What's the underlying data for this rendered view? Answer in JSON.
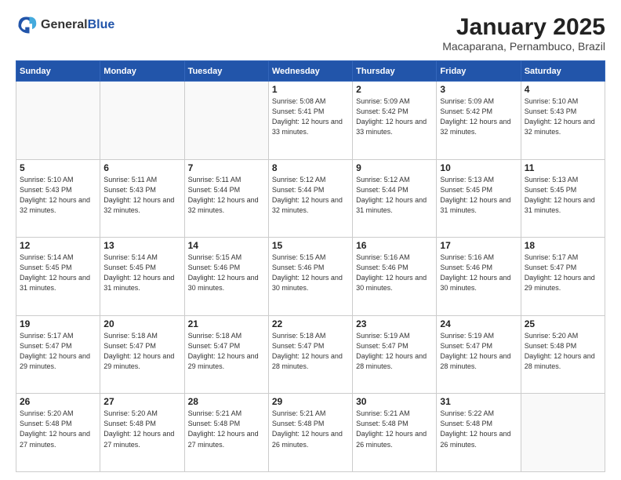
{
  "logo": {
    "general": "General",
    "blue": "Blue"
  },
  "header": {
    "month": "January 2025",
    "location": "Macaparana, Pernambuco, Brazil"
  },
  "weekdays": [
    "Sunday",
    "Monday",
    "Tuesday",
    "Wednesday",
    "Thursday",
    "Friday",
    "Saturday"
  ],
  "weeks": [
    [
      {
        "day": null
      },
      {
        "day": null
      },
      {
        "day": null
      },
      {
        "day": "1",
        "sunrise": "5:08 AM",
        "sunset": "5:41 PM",
        "daylight": "12 hours and 33 minutes."
      },
      {
        "day": "2",
        "sunrise": "5:09 AM",
        "sunset": "5:42 PM",
        "daylight": "12 hours and 33 minutes."
      },
      {
        "day": "3",
        "sunrise": "5:09 AM",
        "sunset": "5:42 PM",
        "daylight": "12 hours and 32 minutes."
      },
      {
        "day": "4",
        "sunrise": "5:10 AM",
        "sunset": "5:43 PM",
        "daylight": "12 hours and 32 minutes."
      }
    ],
    [
      {
        "day": "5",
        "sunrise": "5:10 AM",
        "sunset": "5:43 PM",
        "daylight": "12 hours and 32 minutes."
      },
      {
        "day": "6",
        "sunrise": "5:11 AM",
        "sunset": "5:43 PM",
        "daylight": "12 hours and 32 minutes."
      },
      {
        "day": "7",
        "sunrise": "5:11 AM",
        "sunset": "5:44 PM",
        "daylight": "12 hours and 32 minutes."
      },
      {
        "day": "8",
        "sunrise": "5:12 AM",
        "sunset": "5:44 PM",
        "daylight": "12 hours and 32 minutes."
      },
      {
        "day": "9",
        "sunrise": "5:12 AM",
        "sunset": "5:44 PM",
        "daylight": "12 hours and 31 minutes."
      },
      {
        "day": "10",
        "sunrise": "5:13 AM",
        "sunset": "5:45 PM",
        "daylight": "12 hours and 31 minutes."
      },
      {
        "day": "11",
        "sunrise": "5:13 AM",
        "sunset": "5:45 PM",
        "daylight": "12 hours and 31 minutes."
      }
    ],
    [
      {
        "day": "12",
        "sunrise": "5:14 AM",
        "sunset": "5:45 PM",
        "daylight": "12 hours and 31 minutes."
      },
      {
        "day": "13",
        "sunrise": "5:14 AM",
        "sunset": "5:45 PM",
        "daylight": "12 hours and 31 minutes."
      },
      {
        "day": "14",
        "sunrise": "5:15 AM",
        "sunset": "5:46 PM",
        "daylight": "12 hours and 30 minutes."
      },
      {
        "day": "15",
        "sunrise": "5:15 AM",
        "sunset": "5:46 PM",
        "daylight": "12 hours and 30 minutes."
      },
      {
        "day": "16",
        "sunrise": "5:16 AM",
        "sunset": "5:46 PM",
        "daylight": "12 hours and 30 minutes."
      },
      {
        "day": "17",
        "sunrise": "5:16 AM",
        "sunset": "5:46 PM",
        "daylight": "12 hours and 30 minutes."
      },
      {
        "day": "18",
        "sunrise": "5:17 AM",
        "sunset": "5:47 PM",
        "daylight": "12 hours and 29 minutes."
      }
    ],
    [
      {
        "day": "19",
        "sunrise": "5:17 AM",
        "sunset": "5:47 PM",
        "daylight": "12 hours and 29 minutes."
      },
      {
        "day": "20",
        "sunrise": "5:18 AM",
        "sunset": "5:47 PM",
        "daylight": "12 hours and 29 minutes."
      },
      {
        "day": "21",
        "sunrise": "5:18 AM",
        "sunset": "5:47 PM",
        "daylight": "12 hours and 29 minutes."
      },
      {
        "day": "22",
        "sunrise": "5:18 AM",
        "sunset": "5:47 PM",
        "daylight": "12 hours and 28 minutes."
      },
      {
        "day": "23",
        "sunrise": "5:19 AM",
        "sunset": "5:47 PM",
        "daylight": "12 hours and 28 minutes."
      },
      {
        "day": "24",
        "sunrise": "5:19 AM",
        "sunset": "5:47 PM",
        "daylight": "12 hours and 28 minutes."
      },
      {
        "day": "25",
        "sunrise": "5:20 AM",
        "sunset": "5:48 PM",
        "daylight": "12 hours and 28 minutes."
      }
    ],
    [
      {
        "day": "26",
        "sunrise": "5:20 AM",
        "sunset": "5:48 PM",
        "daylight": "12 hours and 27 minutes."
      },
      {
        "day": "27",
        "sunrise": "5:20 AM",
        "sunset": "5:48 PM",
        "daylight": "12 hours and 27 minutes."
      },
      {
        "day": "28",
        "sunrise": "5:21 AM",
        "sunset": "5:48 PM",
        "daylight": "12 hours and 27 minutes."
      },
      {
        "day": "29",
        "sunrise": "5:21 AM",
        "sunset": "5:48 PM",
        "daylight": "12 hours and 26 minutes."
      },
      {
        "day": "30",
        "sunrise": "5:21 AM",
        "sunset": "5:48 PM",
        "daylight": "12 hours and 26 minutes."
      },
      {
        "day": "31",
        "sunrise": "5:22 AM",
        "sunset": "5:48 PM",
        "daylight": "12 hours and 26 minutes."
      },
      {
        "day": null
      }
    ]
  ]
}
